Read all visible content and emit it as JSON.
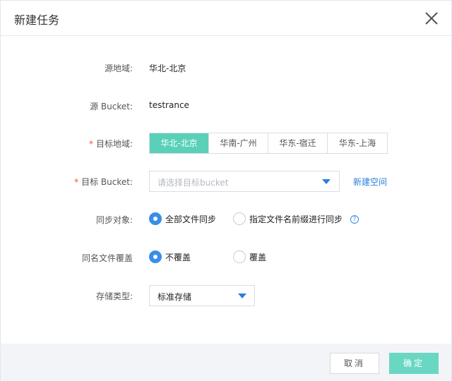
{
  "dialog": {
    "title": "新建任务",
    "close_icon": "close-icon"
  },
  "form": {
    "source_region": {
      "label": "源地域:",
      "value": "华北-北京"
    },
    "source_bucket": {
      "label": "源 Bucket:",
      "value": "testrance"
    },
    "target_region": {
      "required_mark": "*",
      "label": "目标地域:",
      "options": [
        "华北-北京",
        "华南-广州",
        "华东-宿迁",
        "华东-上海"
      ],
      "selected": "华北-北京"
    },
    "target_bucket": {
      "required_mark": "*",
      "label": "目标 Bucket:",
      "placeholder": "请选择目标bucket",
      "new_link": "新建空间"
    },
    "sync_object": {
      "label": "同步对象:",
      "options": [
        "全部文件同步",
        "指定文件名前缀进行同步"
      ],
      "selected": "全部文件同步",
      "help_icon": "?"
    },
    "overwrite": {
      "label": "同名文件覆盖",
      "options": [
        "不覆盖",
        "覆盖"
      ],
      "selected": "不覆盖"
    },
    "storage_type": {
      "label": "存储类型:",
      "value": "标准存储"
    }
  },
  "footer": {
    "cancel_label": "取消",
    "ok_label": "确定"
  },
  "colors": {
    "accent_green": "#5ad0b8",
    "accent_blue": "#3a8ee6",
    "required_red": "#f04b3e",
    "footer_bg": "#f2f4f8"
  }
}
